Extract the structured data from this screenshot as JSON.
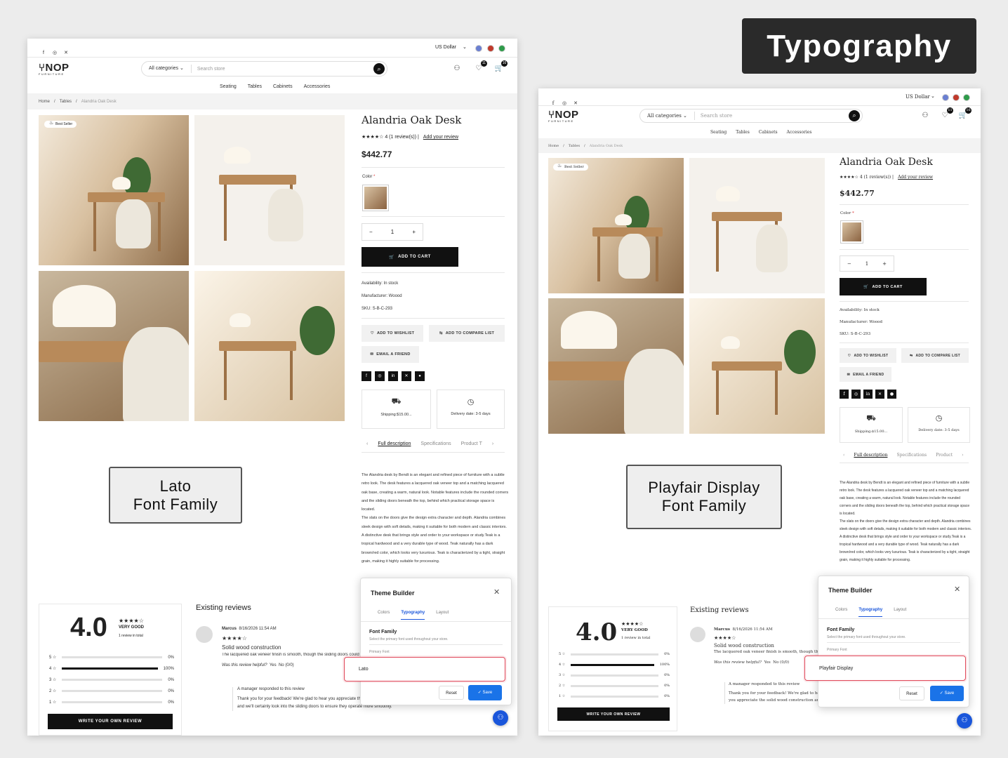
{
  "banner": "Typography",
  "store": {
    "currency": "US Dollar",
    "logo": "NOP",
    "logo_sub": "FURNITURE",
    "categories": "All categories",
    "search_placeholder": "Search store",
    "wishlist_count": "11",
    "cart_count": "16",
    "menu": [
      "Seating",
      "Tables",
      "Cabinets",
      "Accessories"
    ],
    "breadcrumb": {
      "home": "Home",
      "section": "Tables",
      "current": "Alandria Oak Desk"
    },
    "best_seller": "Best Seller",
    "product": {
      "title": "Alandria Oak Desk",
      "stars": "★★★★☆",
      "rating_text": "4  (1 review(s))   |",
      "add_review": "Add your review",
      "price": "$442.77",
      "color_label": "Color",
      "required": "*",
      "qty": "1",
      "minus": "−",
      "plus": "+",
      "add_to_cart": "ADD TO CART",
      "availability": "Availability: In stock",
      "manufacturer": "Manufacturer: Woood",
      "sku": "SKU: S-B-C-293",
      "wishlist": "ADD TO WISHLIST",
      "compare": "ADD TO COMPARE LIST",
      "email": "EMAIL A FRIEND",
      "shipping": "Shipping:$15.00...",
      "delivery": "Delivery date: 3-5 days",
      "tabs": [
        "Full description",
        "Specifications",
        "Product T"
      ],
      "description": "The Alandria desk by Bendt is an elegant and refined piece of furniture with a subtle retro look. The desk features a lacquered oak veneer top and a matching lacquered oak base, creating a warm, natural look. Notable features include the rounded corners and the sliding doors beneath the top, behind which practical storage space is located.\nThe slats on the doors give the design extra character and depth. Alandria combines sleek design with soft details, making it suitable for both modern and classic interiors. A distinctive desk that brings style and order to your workspace or study.Teak is a tropical hardwood and a very durable type of wood. Teak naturally has a dark brown/red color, which looks very luxurious. Teak is characterized by a tight, straight grain, making it highly suitable for processing."
    },
    "reviews": {
      "score": "4.0",
      "stars": "★★★★☆",
      "verdict": "VERY GOOD",
      "total": "1 review in total",
      "rows": [
        {
          "label": "5 ☆",
          "pct": "0%",
          "value": 0
        },
        {
          "label": "4 ☆",
          "pct": "100%",
          "value": 1
        },
        {
          "label": "3 ☆",
          "pct": "0%",
          "value": 0
        },
        {
          "label": "2 ☆",
          "pct": "0%",
          "value": 0
        },
        {
          "label": "1 ☆",
          "pct": "0%",
          "value": 0
        }
      ],
      "write_button": "WRITE YOUR OWN REVIEW",
      "heading": "Existing reviews",
      "author": "Marcus",
      "date": "8/16/2026 11:54 AM",
      "review_stars": "★★★★☆",
      "review_title": "Solid wood construction",
      "review_body": "The lacquered oak veneer finish is smooth, though the sliding doors could be a bit smoother.",
      "helpful": "Was this review helpful?",
      "yes": "Yes",
      "no": "No",
      "counts": "(0/0)",
      "manager": "A manager responded to this review",
      "reply": "Thank you for your feedback! We're glad to hear you appreciate the solid wood construction and the oak veneer finish, and we'll certainly look into the sliding doors to ensure they operate more smoothly."
    }
  },
  "theme_builder": {
    "title": "Theme Builder",
    "tabs": [
      "Colors",
      "Typography",
      "Layout"
    ],
    "section": "Font Family",
    "section_desc": "Select the primary font used throughout your store.",
    "field_label": "Primary Font",
    "reset": "Reset",
    "save": "Save"
  },
  "left": {
    "callout_line1": "Lato",
    "callout_line2": "Font Family",
    "font_value": "Lato"
  },
  "right": {
    "callout_line1": "Playfair Display",
    "callout_line2": "Font Family",
    "font_value": "Playfair Display"
  }
}
